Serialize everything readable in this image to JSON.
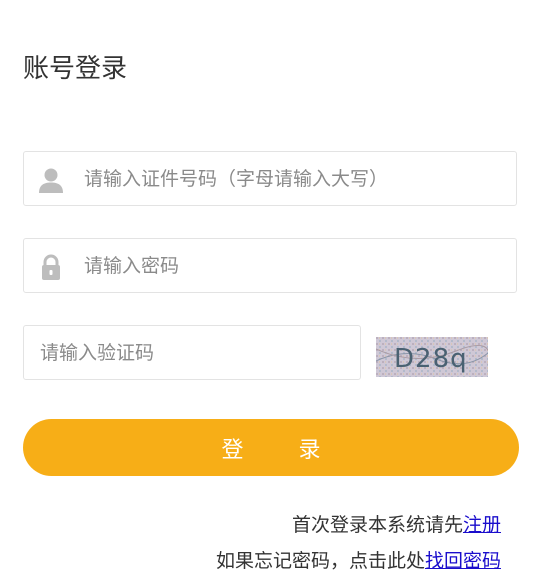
{
  "page": {
    "title": "账号登录"
  },
  "form": {
    "id_placeholder": "请输入证件号码（字母请输入大写）",
    "password_placeholder": "请输入密码",
    "captcha_placeholder": "请输入验证码",
    "captcha_text": "D28q",
    "login_label": "登 录"
  },
  "footer": {
    "register_prefix": "首次登录本系统请先",
    "register_link": "注册",
    "forgot_prefix": "如果忘记密码，点击此处",
    "forgot_link": "找回密码"
  },
  "icons": {
    "user": "user-icon",
    "lock": "lock-icon"
  },
  "colors": {
    "accent": "#f7ae17",
    "link": "#1a0dcc",
    "border": "#e3e3e3"
  }
}
